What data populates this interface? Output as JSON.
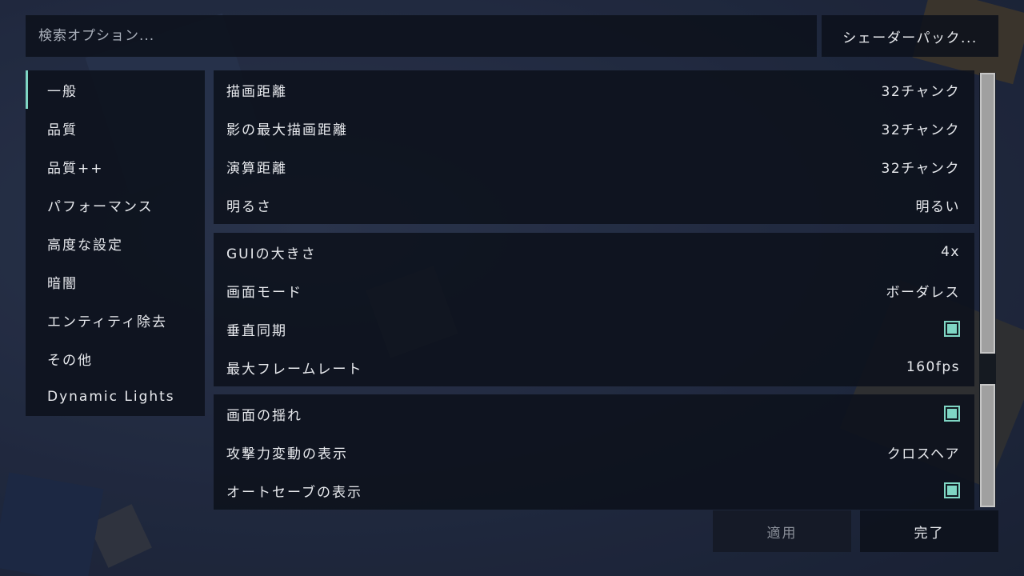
{
  "search": {
    "placeholder": "検索オプション..."
  },
  "shader_button": {
    "label": "シェーダーパック..."
  },
  "sidebar": {
    "items": [
      {
        "label": "一般",
        "active": true
      },
      {
        "label": "品質"
      },
      {
        "label": "品質++"
      },
      {
        "label": "パフォーマンス"
      },
      {
        "label": "高度な設定"
      },
      {
        "label": "暗闇"
      },
      {
        "label": "エンティティ除去"
      },
      {
        "label": "その他"
      },
      {
        "label": "Dynamic Lights"
      }
    ]
  },
  "groups": [
    {
      "rows": [
        {
          "label": "描画距離",
          "value": "32チャンク"
        },
        {
          "label": "影の最大描画距離",
          "value": "32チャンク"
        },
        {
          "label": "演算距離",
          "value": "32チャンク"
        },
        {
          "label": "明るさ",
          "value": "明るい"
        }
      ]
    },
    {
      "rows": [
        {
          "label": "GUIの大きさ",
          "value": "4x"
        },
        {
          "label": "画面モード",
          "value": "ボーダレス"
        },
        {
          "label": "垂直同期",
          "checked": true
        },
        {
          "label": "最大フレームレート",
          "value": "160fps"
        }
      ]
    },
    {
      "rows": [
        {
          "label": "画面の揺れ",
          "checked": true
        },
        {
          "label": "攻撃力変動の表示",
          "value": "クロスヘア"
        },
        {
          "label": "オートセーブの表示",
          "checked": true
        }
      ]
    }
  ],
  "buttons": {
    "apply": "適用",
    "done": "完了"
  },
  "colors": {
    "accent": "#7fd6c4",
    "panel": "#0c111b",
    "background": "#2a3550"
  }
}
